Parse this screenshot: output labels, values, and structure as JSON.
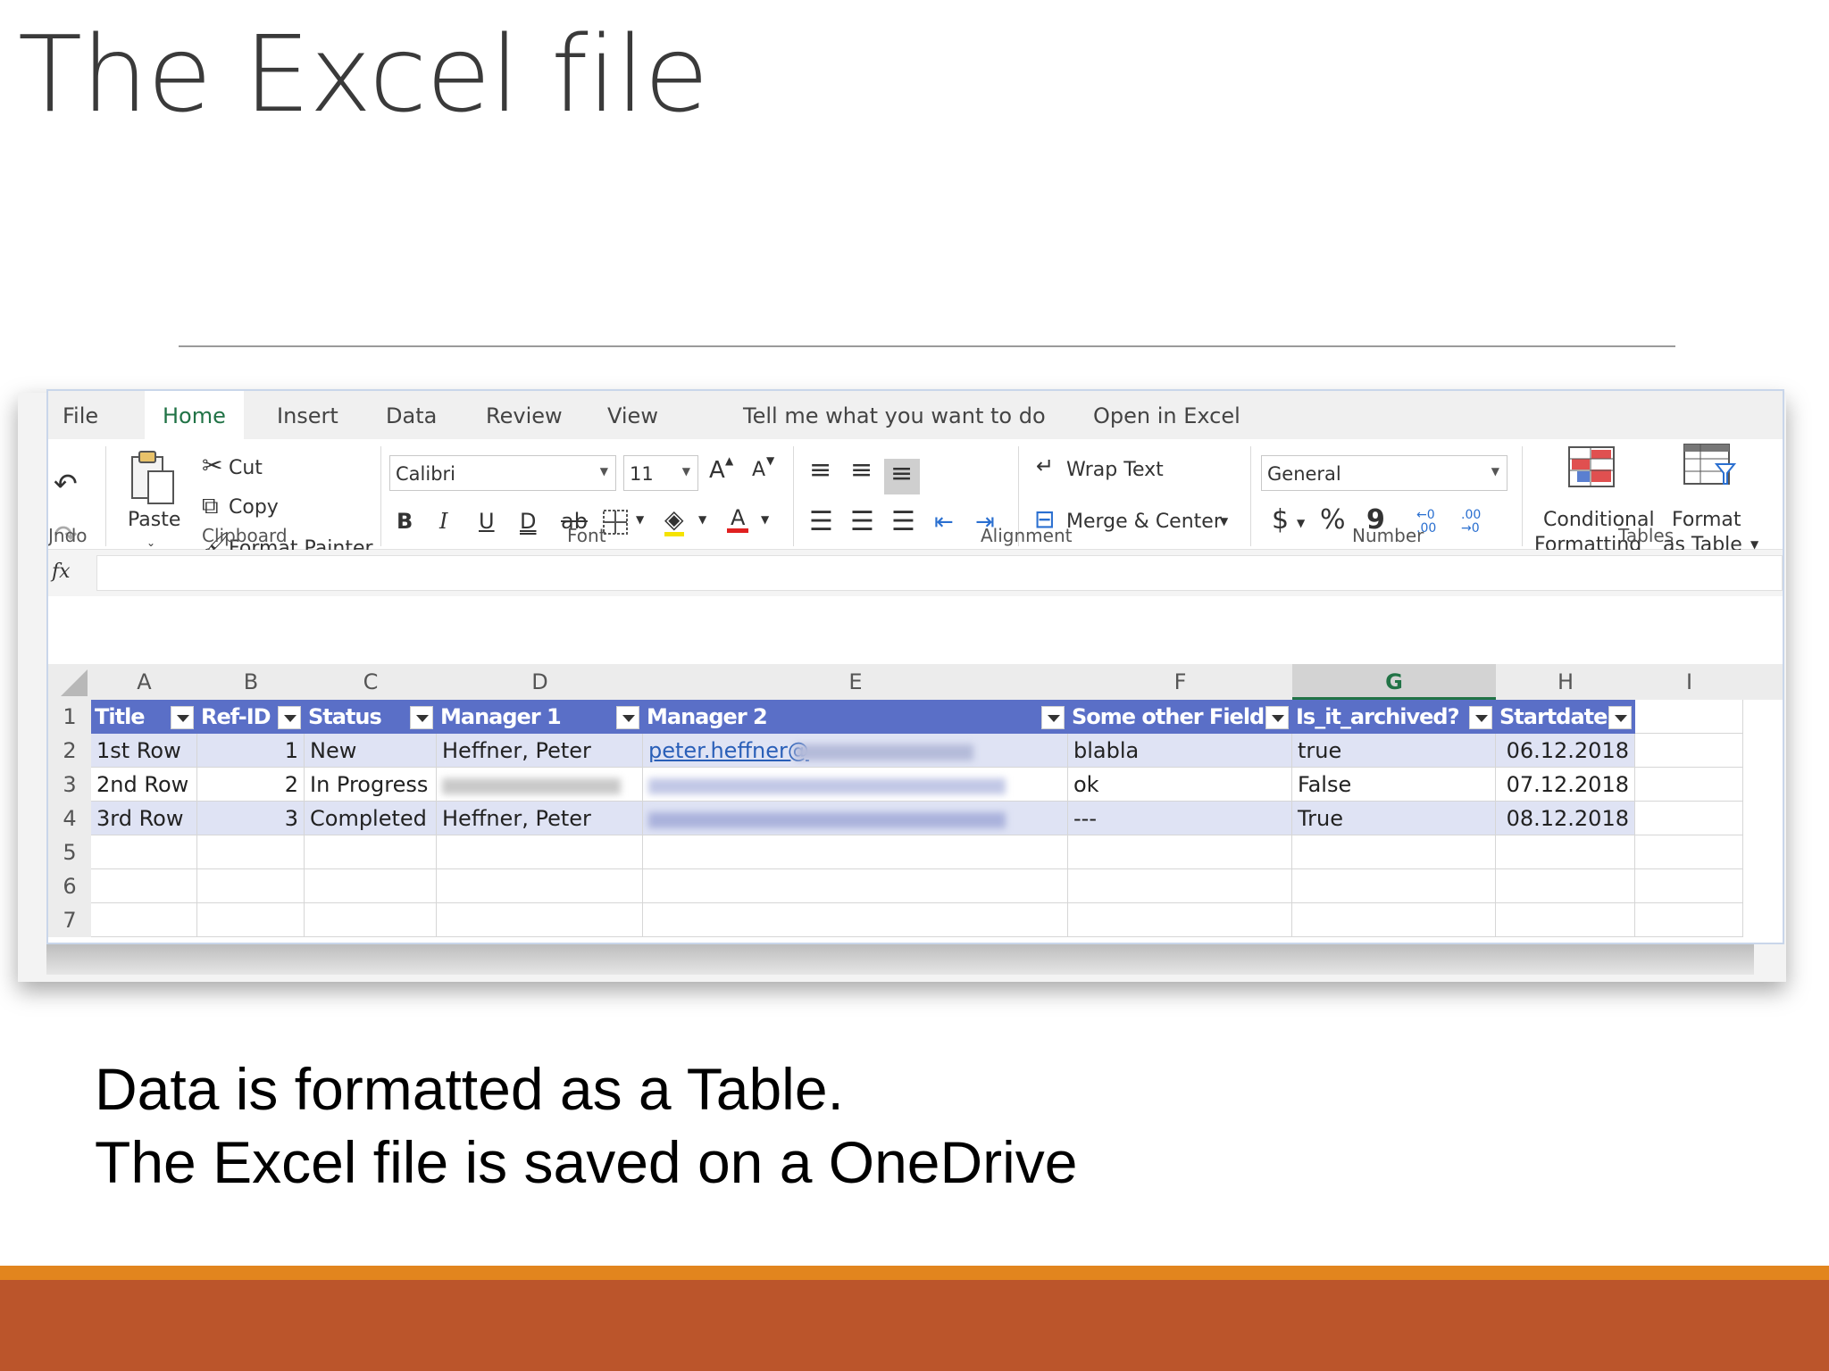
{
  "slide": {
    "title": "The Excel file",
    "caption_lines": [
      "Data is formatted as a Table.",
      "The Excel file is saved on a OneDrive"
    ],
    "accent_orange": "#e2851e",
    "accent_footer": "#bb552b"
  },
  "excel": {
    "menu_tabs": [
      "File",
      "Home",
      "Insert",
      "Data",
      "Review",
      "View"
    ],
    "active_tab": "Home",
    "tell_me": "Tell me what you want to do",
    "open_in_excel": "Open in Excel",
    "ribbon": {
      "undo_label": "Undo",
      "undo_label_visible": "Jndo",
      "clipboard": {
        "paste": "Paste",
        "cut": "Cut",
        "copy": "Copy",
        "format_painter": "Format Painter",
        "group": "Clipboard"
      },
      "font": {
        "name": "Calibri",
        "size": "11",
        "group": "Font",
        "grow": "A",
        "shrink": "A",
        "bold": "B",
        "italic": "I",
        "underline": "U",
        "double_underline": "D",
        "strike": "ab",
        "font_color": "A"
      },
      "alignment": {
        "wrap_text": "Wrap Text",
        "merge_center": "Merge & Center",
        "group": "Alignment"
      },
      "number": {
        "format": "General",
        "currency": "$",
        "percent": "%",
        "comma": "9",
        "group": "Number",
        "inc_decimal": "←0 .00",
        "dec_decimal": ".00 →0"
      },
      "tables": {
        "conditional_1": "Conditional",
        "conditional_2": "Formatting",
        "format_1": "Format",
        "format_2": "as Table",
        "group": "Tables"
      }
    },
    "formula_bar": {
      "fx": "fx",
      "value": ""
    },
    "columns": [
      "A",
      "B",
      "C",
      "D",
      "E",
      "F",
      "G",
      "H",
      "I"
    ],
    "selected_column": "G",
    "row_numbers": [
      "1",
      "2",
      "3",
      "4",
      "5",
      "6",
      "7"
    ],
    "table_headers": [
      "Title",
      "Ref-ID",
      "Status",
      "Manager 1",
      "Manager 2",
      "Some other Field",
      "Is_it_archived?",
      "Startdate"
    ],
    "rows": [
      {
        "title": "1st Row",
        "ref_id": "1",
        "status": "New",
        "manager1": "Heffner, Peter",
        "manager2": "peter.heffner@",
        "other": "blabla",
        "archived": "true",
        "startdate": "06.12.2018"
      },
      {
        "title": "2nd Row",
        "ref_id": "2",
        "status": "In Progress",
        "manager1": "",
        "manager2": "",
        "other": "ok",
        "archived": "False",
        "startdate": "07.12.2018"
      },
      {
        "title": "3rd Row",
        "ref_id": "3",
        "status": "Completed",
        "manager1": "Heffner, Peter",
        "manager2": "",
        "other": "---",
        "archived": "True",
        "startdate": "08.12.2018"
      }
    ],
    "table_header_color": "#5a6fc7",
    "band_color": "#dfe3f4",
    "accent_green": "#217346"
  }
}
